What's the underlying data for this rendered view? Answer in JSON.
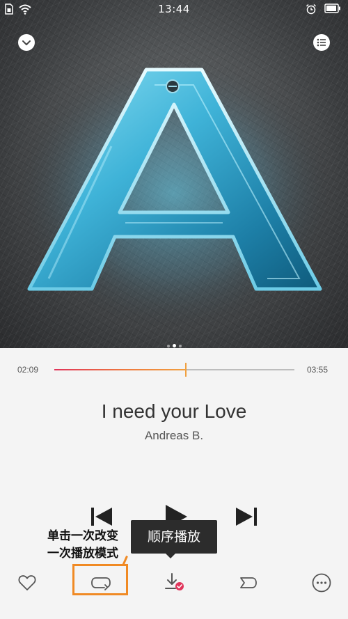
{
  "status_bar": {
    "time": "13:44",
    "icons": [
      "sim-card-icon",
      "wifi-icon",
      "alarm-clock-icon",
      "battery-icon"
    ]
  },
  "album_art": {
    "letter": "A",
    "page_index": 1,
    "page_count": 3
  },
  "top_controls": {
    "collapse_icon": "chevron-down-icon",
    "playlist_icon": "playlist-icon"
  },
  "progress": {
    "elapsed": "02:09",
    "total": "03:55",
    "fraction": 0.549
  },
  "song": {
    "title": "I need your Love",
    "artist": "Andreas B."
  },
  "playback": {
    "icons": [
      "previous-icon",
      "play-icon",
      "next-icon"
    ]
  },
  "bottom_bar": {
    "icons": [
      "heart-icon",
      "repeat-mode-icon",
      "download-icon",
      "share-icon",
      "more-icon"
    ]
  },
  "annotation": {
    "line1": "单击一次改变",
    "line2": "一次播放模式",
    "tooltip": "顺序播放",
    "highlight_color": "#f08a24"
  },
  "colors": {
    "progress_start": "#e0345a",
    "progress_end": "#f0a040",
    "accent_badge": "#e0345a"
  }
}
